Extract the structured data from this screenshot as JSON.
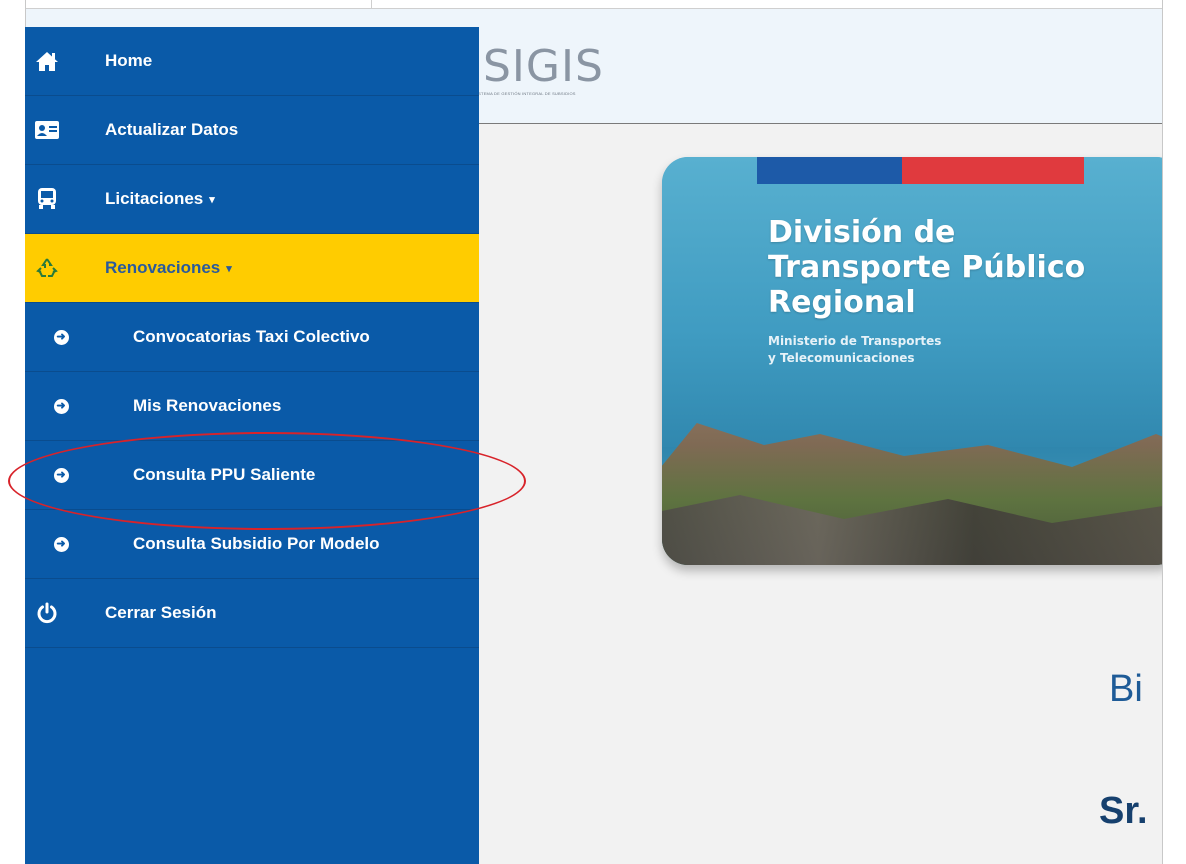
{
  "header": {
    "logo_text": "SIGIS",
    "logo_subtitle": "SISTEMA DE GESTIÓN INTEGRAL DE SUBSIDIOS"
  },
  "banner": {
    "title_line1": "División de",
    "title_line2": "Transporte Público",
    "title_line3": "Regional",
    "subtitle_line1": "Ministerio de Transportes",
    "subtitle_line2": "y Telecomunicaciones"
  },
  "main": {
    "welcome_text": "Bi",
    "greeting_text": "Sr."
  },
  "sidebar": {
    "items": [
      {
        "label": "Home",
        "icon": "home-icon"
      },
      {
        "label": "Actualizar Datos",
        "icon": "id-card-icon"
      },
      {
        "label": "Licitaciones",
        "icon": "bus-icon"
      },
      {
        "label": "Renovaciones",
        "icon": "recycle-icon"
      },
      {
        "label": "Convocatorias Taxi Colectivo",
        "icon": "arrow-circle-right-icon"
      },
      {
        "label": "Mis Renovaciones",
        "icon": "arrow-circle-right-icon"
      },
      {
        "label": "Consulta PPU Saliente",
        "icon": "arrow-circle-right-icon"
      },
      {
        "label": "Consulta Subsidio Por Modelo",
        "icon": "arrow-circle-right-icon"
      },
      {
        "label": "Cerrar Sesión",
        "icon": "power-icon"
      }
    ]
  },
  "colors": {
    "sidebar_bg": "#0a5aa8",
    "active_item_bg": "#ffcc00",
    "annotation_red": "#d8232a"
  }
}
